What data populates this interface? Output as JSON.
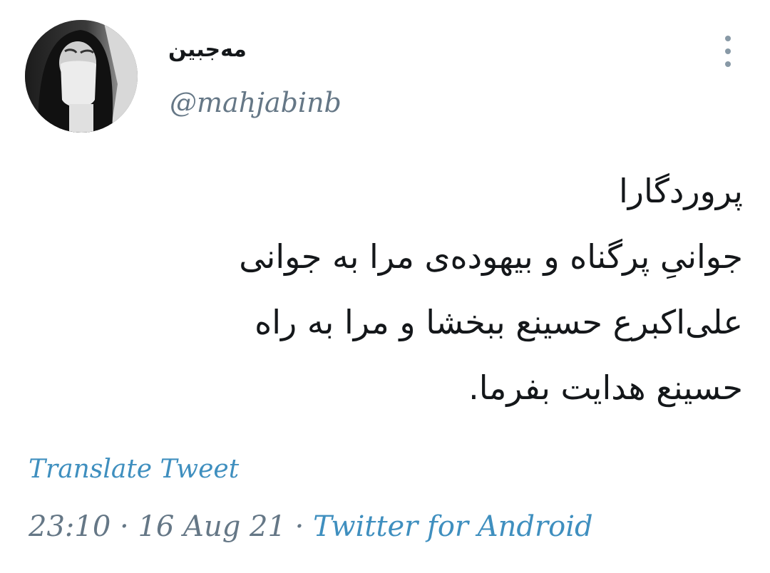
{
  "user": {
    "display_name": "مه‌جبین",
    "handle": "@mahjabinb"
  },
  "tweet": {
    "lines": [
      "پروردگارا",
      "جوانیِ پرگناه و بیهوده‌ی مرا به جوانی",
      "علی‌اکبرع حسینع ببخشا و مرا به راه",
      "حسینع هدایت بفرما."
    ]
  },
  "actions": {
    "translate_label": "Translate Tweet",
    "more_icon": "more-vertical-icon"
  },
  "meta": {
    "time": "23:10",
    "separator": "·",
    "date": "16 Aug 21",
    "source": "Twitter for Android"
  },
  "colors": {
    "link": "#3f8fbf",
    "secondary_text": "#657786",
    "primary_text": "#14171a"
  }
}
